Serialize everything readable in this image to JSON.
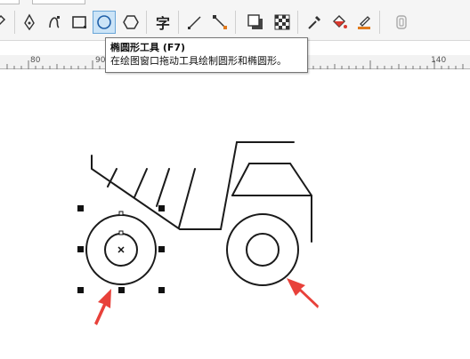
{
  "toolbar": {
    "tools": [
      {
        "id": "freehand",
        "icon": "freehand-pick-icon"
      },
      {
        "id": "pen",
        "icon": "pen-tool-icon"
      },
      {
        "id": "bspline",
        "icon": "artistic-media-icon"
      },
      {
        "id": "rectangle",
        "icon": "rectangle-tool-icon"
      },
      {
        "id": "ellipse",
        "icon": "ellipse-tool-icon",
        "active": true
      },
      {
        "id": "polygon",
        "icon": "polygon-tool-icon"
      },
      {
        "id": "text",
        "icon": "text-tool-icon",
        "label": "字"
      },
      {
        "id": "dimension",
        "icon": "parallel-dimension-icon"
      },
      {
        "id": "connector",
        "icon": "connector-tool-icon"
      },
      {
        "id": "drop-shadow",
        "icon": "drop-shadow-icon"
      },
      {
        "id": "transparency",
        "icon": "transparency-icon"
      },
      {
        "id": "eyedropper",
        "icon": "eyedropper-icon"
      },
      {
        "id": "interactive-fill",
        "icon": "interactive-fill-icon"
      },
      {
        "id": "smart-fill",
        "icon": "smart-fill-icon"
      },
      {
        "id": "mesh",
        "icon": "mesh-fill-icon"
      }
    ]
  },
  "ruler": {
    "labels": [
      "80",
      "90",
      "140"
    ]
  },
  "tooltip": {
    "title": "椭圆形工具 (F7)",
    "description": "在绘图窗口拖动工具绘制圆形和椭圆形。"
  },
  "colors": {
    "accent": "#6aa6d8",
    "arrow": "#e8413a",
    "active_tool_bg": "#cce4f7"
  }
}
